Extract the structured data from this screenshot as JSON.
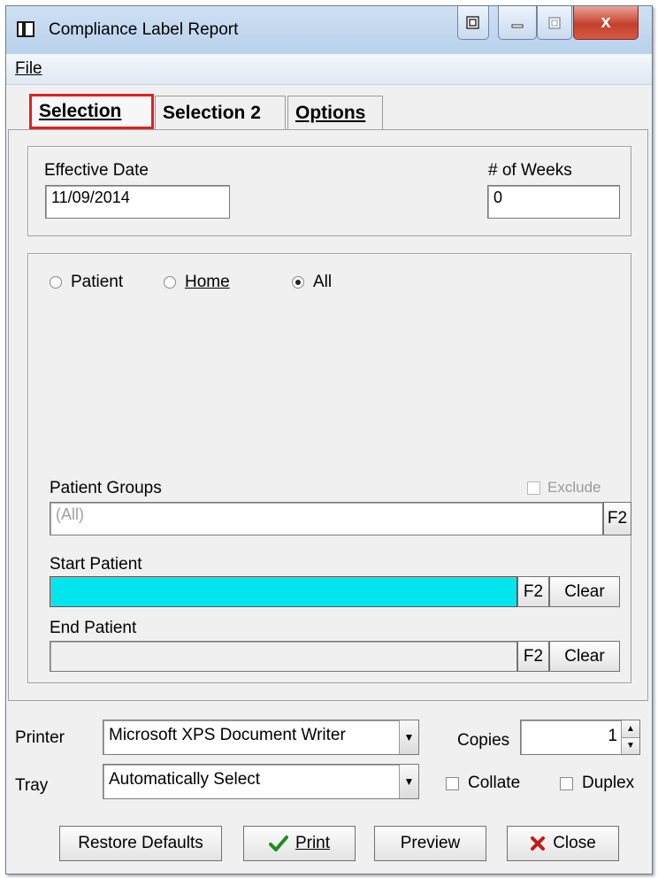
{
  "window": {
    "title": "Compliance Label Report",
    "close_glyph": "x"
  },
  "menu": {
    "file": "File"
  },
  "tabs": [
    {
      "label": "Selection",
      "active": true
    },
    {
      "label": "Selection 2",
      "active": false
    },
    {
      "label": "Options",
      "active": false
    }
  ],
  "dates": {
    "effective_date_label": "Effective Date",
    "effective_date_value": "11/09/2014",
    "weeks_label": "# of Weeks",
    "weeks_value": "0"
  },
  "selection": {
    "radios": [
      {
        "label": "Patient",
        "checked": false
      },
      {
        "label": "Home",
        "checked": false
      },
      {
        "label": "All",
        "checked": true
      }
    ],
    "patient_groups_label": "Patient Groups",
    "exclude_label": "Exclude",
    "patient_groups_value": "(All)",
    "start_patient_label": "Start Patient",
    "start_patient_value": "",
    "end_patient_label": "End Patient",
    "end_patient_value": "",
    "f2_label": "F2",
    "clear_label": "Clear",
    "start_highlight_color": "#00e5ee"
  },
  "print": {
    "printer_label": "Printer",
    "printer_value": "Microsoft XPS Document Writer",
    "tray_label": "Tray",
    "tray_value": "Automatically Select",
    "copies_label": "Copies",
    "copies_value": "1",
    "collate_label": "Collate",
    "duplex_label": "Duplex"
  },
  "buttons": {
    "restore_defaults": "Restore Defaults",
    "print": "Print",
    "preview": "Preview",
    "close": "Close"
  },
  "colors": {
    "active_tab_border": "#e02020",
    "print_check": "#1f8a1f",
    "close_x": "#c41a1a"
  }
}
